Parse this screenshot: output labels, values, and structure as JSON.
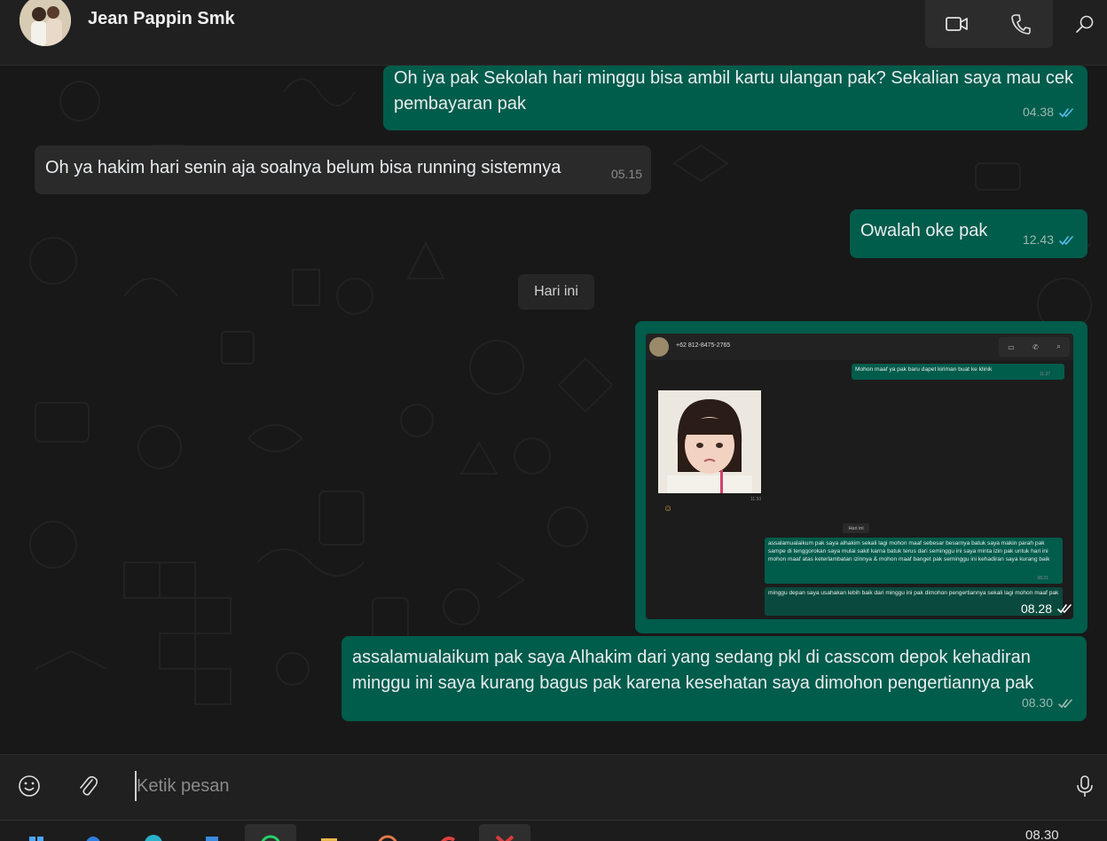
{
  "header": {
    "contact_name": "Jean Pappin Smk",
    "video_call_icon": "video-camera-icon",
    "voice_call_icon": "phone-icon",
    "search_icon": "search-icon"
  },
  "messages": [
    {
      "direction": "out",
      "text": "Oh iya pak Sekolah hari minggu bisa ambil kartu ulangan pak? Sekalian saya mau cek pembayaran pak",
      "time": "04.38",
      "status": "read"
    },
    {
      "direction": "in",
      "text": "Oh ya hakim hari senin aja soalnya belum bisa running sistemnya",
      "time": "05.15"
    },
    {
      "direction": "out",
      "text": "Owalah oke pak",
      "time": "12.43",
      "status": "read"
    },
    {
      "direction": "out",
      "type": "image",
      "time": "08.28",
      "status": "delivered"
    },
    {
      "direction": "out",
      "text": "assalamualaikum pak saya Alhakim dari yang sedang pkl di casscom depok kehadiran minggu ini saya kurang bagus pak karena kesehatan saya dimohon pengertiannya pak",
      "time": "08.30",
      "status": "delivered"
    }
  ],
  "day_divider": "Hari ini",
  "screenshot_image": {
    "contact": "+62 812-8475-2765",
    "msg1": "Mohon maaf ya pak baru dapet kiriman buat ke klinik",
    "msg1_time": "11.37",
    "photo_time": "11.53",
    "day": "Hari ini",
    "msg2": "assalamualaikum pak saya alhakim sekali lagi mohon maaf sebesar besarnya batuk saya makin parah pak sampe di tenggorokan saya mulai sakit karna batuk terus dari seminggu ini saya minta izin pak untuk hari ini mohon maaf atas keterlambatan izinnya & mohon maaf banget pak seminggu ini kehadiran saya kurang baik",
    "msg2_time": "08.21",
    "msg3": "minggu depan saya usahakan lebih baik dari minggu ini pak dimohon pengertiannya sekali lagi mohon maaf pak"
  },
  "composer": {
    "placeholder": "Ketik pesan",
    "emoji_icon": "emoji-icon",
    "attach_icon": "paperclip-icon",
    "mic_icon": "microphone-icon"
  },
  "taskbar": {
    "clock": "08.30"
  },
  "colors": {
    "outgoing_bubble": "#005c4b",
    "incoming_bubble": "#2a2a2a",
    "read_tick": "#53bdeb",
    "background": "#181818"
  }
}
